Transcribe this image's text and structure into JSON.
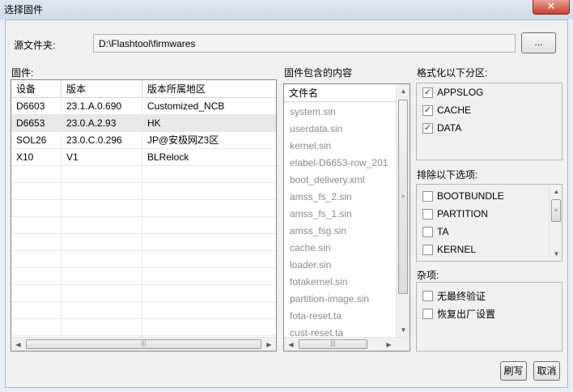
{
  "window": {
    "title": "选择固件",
    "close_glyph": "✕"
  },
  "source": {
    "label": "源文件夹:",
    "path": "D:\\Flashtool\\firmwares",
    "browse_label": "..."
  },
  "firmware": {
    "label": "固件:",
    "columns": [
      "设备",
      "版本",
      "版本所属地区"
    ],
    "rows": [
      [
        "D6603",
        "23.1.A.0.690",
        "Customized_NCB"
      ],
      [
        "D6653",
        "23.0.A.2.93",
        "HK"
      ],
      [
        "SOL26",
        "23.0.C.0.296",
        "JP@安极网Z3区"
      ],
      [
        "X10",
        "V1",
        "BLRelock"
      ]
    ],
    "selected_index": 1
  },
  "contents": {
    "label": "固件包含的内容",
    "column": "文件名",
    "files": [
      "system.sin",
      "userdata.sin",
      "kernel.sin",
      "elabel-D6653-row_201",
      "boot_delivery.xml",
      "amss_fs_2.sin",
      "amss_fs_1.sin",
      "amss_fsg.sin",
      "cache.sin",
      "loader.sin",
      "fotakernel.sin",
      "partition-image.sin",
      "fota-reset.ta",
      "cust-reset.ta"
    ]
  },
  "format": {
    "label": "格式化以下分区:",
    "items": [
      {
        "label": "APPSLOG",
        "checked": true
      },
      {
        "label": "CACHE",
        "checked": true
      },
      {
        "label": "DATA",
        "checked": true
      }
    ]
  },
  "exclude": {
    "label": "排除以下选项:",
    "items": [
      {
        "label": "BOOTBUNDLE",
        "checked": false
      },
      {
        "label": "PARTITION",
        "checked": false
      },
      {
        "label": "TA",
        "checked": false
      },
      {
        "label": "KERNEL",
        "checked": false
      }
    ]
  },
  "misc": {
    "label": "杂项:",
    "items": [
      {
        "label": "无最终验证",
        "checked": false
      },
      {
        "label": "恢复出厂设置",
        "checked": false
      }
    ]
  },
  "buttons": {
    "flash": "刷写",
    "cancel": "取消"
  },
  "glyphs": {
    "check": "✓",
    "up": "▲",
    "down": "▼",
    "left": "◀",
    "right": "▶",
    "grip_v": "≡",
    "grip_h": "|||"
  }
}
